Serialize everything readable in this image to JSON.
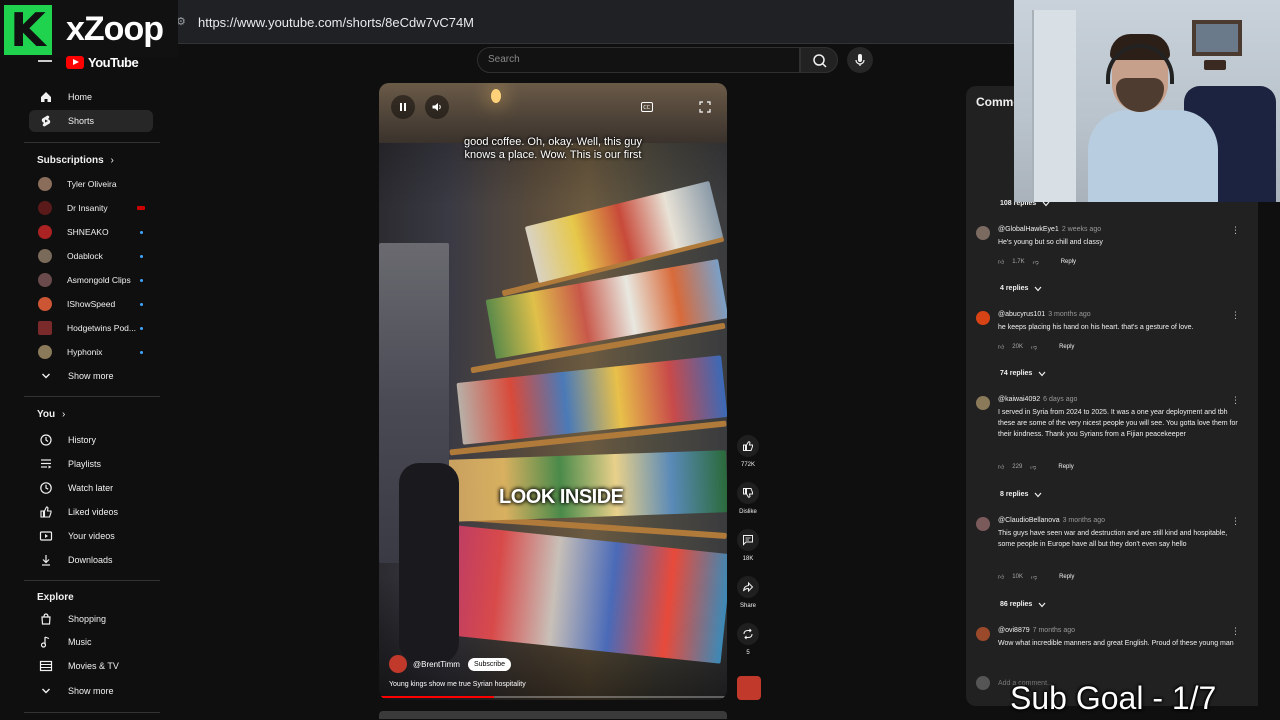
{
  "browser": {
    "url": "https://www.youtube.com/shorts/8eCdw7vC74M"
  },
  "overlay": {
    "logo_letter": "K",
    "logo_text": "xZoop",
    "sub_goal": "Sub Goal - 1/7"
  },
  "header": {
    "brand": "YouTube",
    "search_placeholder": "Search"
  },
  "sidebar": {
    "main": [
      {
        "label": "Home",
        "icon": "home-icon"
      },
      {
        "label": "Shorts",
        "icon": "shorts-icon",
        "active": true
      }
    ],
    "subscriptions_title": "Subscriptions",
    "subscriptions": [
      {
        "label": "Tyler Oliveira",
        "color": "#8a6d5a"
      },
      {
        "label": "Dr Insanity",
        "color": "#5a1a1a"
      },
      {
        "label": "SHNEAKO",
        "color": "#aa2222"
      },
      {
        "label": "Odablock",
        "color": "#7a6a5a"
      },
      {
        "label": "Asmongold Clips",
        "color": "#6a4a4a"
      },
      {
        "label": "IShowSpeed",
        "color": "#cc5533"
      },
      {
        "label": "Hodgetwins Pod...",
        "color": "#7a2a2a"
      },
      {
        "label": "Hyphonix",
        "color": "#8a7a5a"
      }
    ],
    "show_more_1": "Show more",
    "you_title": "You",
    "you_items": [
      {
        "label": "History",
        "icon": "history-icon"
      },
      {
        "label": "Playlists",
        "icon": "playlists-icon"
      },
      {
        "label": "Watch later",
        "icon": "watch-later-icon"
      },
      {
        "label": "Liked videos",
        "icon": "liked-icon"
      },
      {
        "label": "Your videos",
        "icon": "your-videos-icon"
      },
      {
        "label": "Downloads",
        "icon": "downloads-icon"
      }
    ],
    "explore_title": "Explore",
    "explore_items": [
      {
        "label": "Shopping",
        "icon": "shopping-icon"
      },
      {
        "label": "Music",
        "icon": "music-icon"
      },
      {
        "label": "Movies & TV",
        "icon": "movies-icon"
      }
    ],
    "show_more_2": "Show more"
  },
  "video": {
    "caption_line1": "good coffee. Oh, okay. Well, this guy",
    "caption_line2": "knows a place. Wow. This is our first",
    "overlay_text": "LOOK INSIDE",
    "channel": "@BrentTimm",
    "subscribe": "Subscribe",
    "title": "Young kings show me true Syrian hospitality",
    "progress": 0.33
  },
  "actions": {
    "like_count": "772K",
    "dislike_label": "Dislike",
    "comments_count": "18K",
    "share_label": "Share",
    "remix_count": "5"
  },
  "comments": {
    "header": "Comme",
    "first_replies": "108 replies",
    "items": [
      {
        "user": "@GlobalHawkEye1",
        "ago": "2 weeks ago",
        "text": "He's young but so chill and classy",
        "likes": "1.7K",
        "reply": "Reply",
        "replies": "4 replies",
        "avatar": "#7a6a60"
      },
      {
        "user": "@abucyrus101",
        "ago": "3 months ago",
        "text": "he keeps placing his hand on his heart. that's a gesture of love.",
        "likes": "20K",
        "reply": "Reply",
        "replies": "74 replies",
        "avatar": "#d84315"
      },
      {
        "user": "@kaiwai4092",
        "ago": "6 days ago",
        "text": "I served in Syria from 2024 to 2025. It was a one year deployment and tbh these are some of the very nicest people you will see. You gotta love them for their kindness. Thank you Syrians from a Fijian peacekeeper",
        "likes": "229",
        "reply": "Reply",
        "replies": "8 replies",
        "avatar": "#8a7a5a"
      },
      {
        "user": "@ClaudioBellanova",
        "ago": "3 months ago",
        "text": "This guys have seen war and destruction and are still kind and hospitable, some people in Europe have all but they don't even say hello",
        "likes": "10K",
        "reply": "Reply",
        "replies": "86 replies",
        "avatar": "#7a5a5a"
      },
      {
        "user": "@ovi8879",
        "ago": "7 months ago",
        "text": "Wow what incredible manners and great English. Proud of these young man",
        "avatar": "#9a4a2a"
      }
    ],
    "add_comment": "Add a comment..."
  }
}
